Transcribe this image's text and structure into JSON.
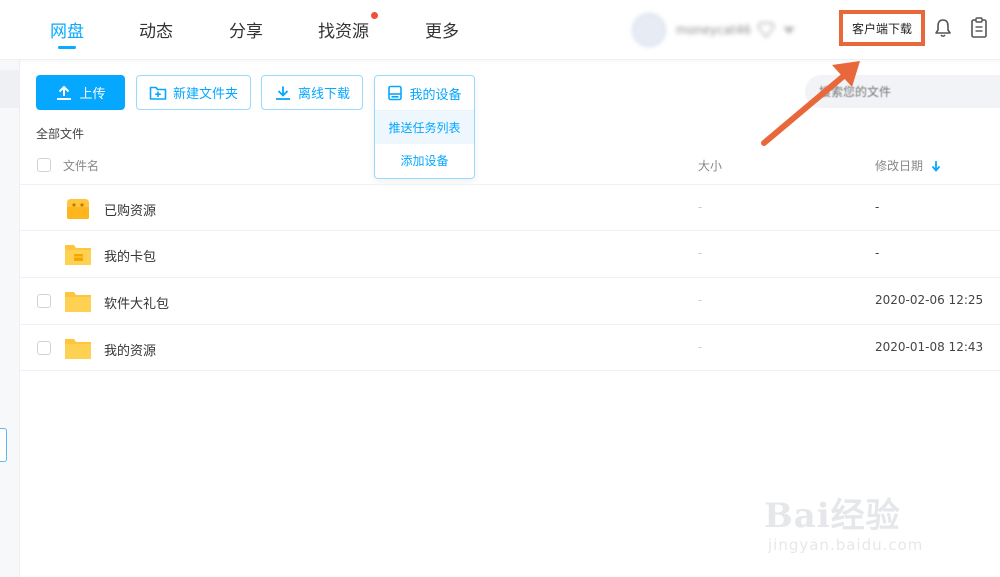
{
  "nav": {
    "tabs": [
      {
        "label": "网盘",
        "active": true
      },
      {
        "label": "动态",
        "active": false
      },
      {
        "label": "分享",
        "active": false
      },
      {
        "label": "找资源",
        "active": false,
        "badge_dot": true
      },
      {
        "label": "更多",
        "active": false
      }
    ],
    "username": "moneycat46",
    "client_download": "客户端下载"
  },
  "toolbar": {
    "upload": "上传",
    "new_folder": "新建文件夹",
    "offline_download": "离线下载",
    "my_devices": "我的设备",
    "device_menu": [
      "推送任务列表",
      "添加设备"
    ]
  },
  "search": {
    "placeholder": "搜索您的文件"
  },
  "breadcrumb": "全部文件",
  "table": {
    "columns": {
      "name": "文件名",
      "size": "大小",
      "date": "修改日期"
    },
    "rows": [
      {
        "name": "已购资源",
        "size": "-",
        "date": "-",
        "icon": "purchased-folder-icon",
        "checkbox": false
      },
      {
        "name": "我的卡包",
        "size": "-",
        "date": "-",
        "icon": "card-folder-icon",
        "checkbox": false
      },
      {
        "name": "软件大礼包",
        "size": "-",
        "date": "2020-02-06 12:25",
        "icon": "folder-icon",
        "checkbox": true
      },
      {
        "name": "我的资源",
        "size": "-",
        "date": "2020-01-08 12:43",
        "icon": "folder-icon",
        "checkbox": true
      }
    ]
  },
  "watermark": {
    "main": "Bai经验",
    "sub": "jingyan.baidu.com"
  },
  "colors": {
    "accent": "#06a7ff",
    "highlight": "#e8673b",
    "folder": "#ffc53d"
  }
}
